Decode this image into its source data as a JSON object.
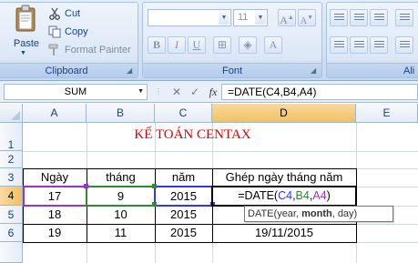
{
  "ribbon": {
    "clipboard": {
      "paste_label": "Paste",
      "cut_label": "Cut",
      "copy_label": "Copy",
      "format_painter_label": "Format Painter",
      "group_label": "Clipboard"
    },
    "font": {
      "font_name": "",
      "font_size": "11",
      "group_label": "Font"
    },
    "alignment": {
      "group_label": "Ali"
    }
  },
  "formula_bar": {
    "name_box": "SUM",
    "cancel_icon": "✕",
    "enter_icon": "✓",
    "fx_label": "fx",
    "formula": "=DATE(C4,B4,A4)"
  },
  "columns": [
    "A",
    "B",
    "C",
    "D",
    "E"
  ],
  "rows": [
    "1",
    "2",
    "3",
    "4",
    "5",
    "6"
  ],
  "sheet": {
    "title": "KẾ TOÁN CENTAX",
    "headers": [
      "Ngày",
      "tháng",
      "năm",
      "Ghép ngày tháng năm"
    ],
    "data": [
      [
        "17",
        "9",
        "2015",
        ""
      ],
      [
        "18",
        "10",
        "2015",
        ""
      ],
      [
        "19",
        "11",
        "2015",
        "19/11/2015"
      ]
    ],
    "editing_cell": {
      "prefix": "=DATE(",
      "ref1": "C4",
      "sep1": ",",
      "ref2": "B4",
      "sep2": ",",
      "ref3": "A4",
      "suffix": ")"
    },
    "tooltip": {
      "fn": "DATE(",
      "arg1": "year, ",
      "arg2": "month",
      "arg3": ", day)"
    }
  },
  "colors": {
    "title": "#e00000",
    "ref_c4": "#3333ff",
    "ref_b4": "#2e8b2e",
    "ref_a4": "#9933cc",
    "ribbon_label": "#15428b",
    "active_header": "#f1c15f"
  }
}
